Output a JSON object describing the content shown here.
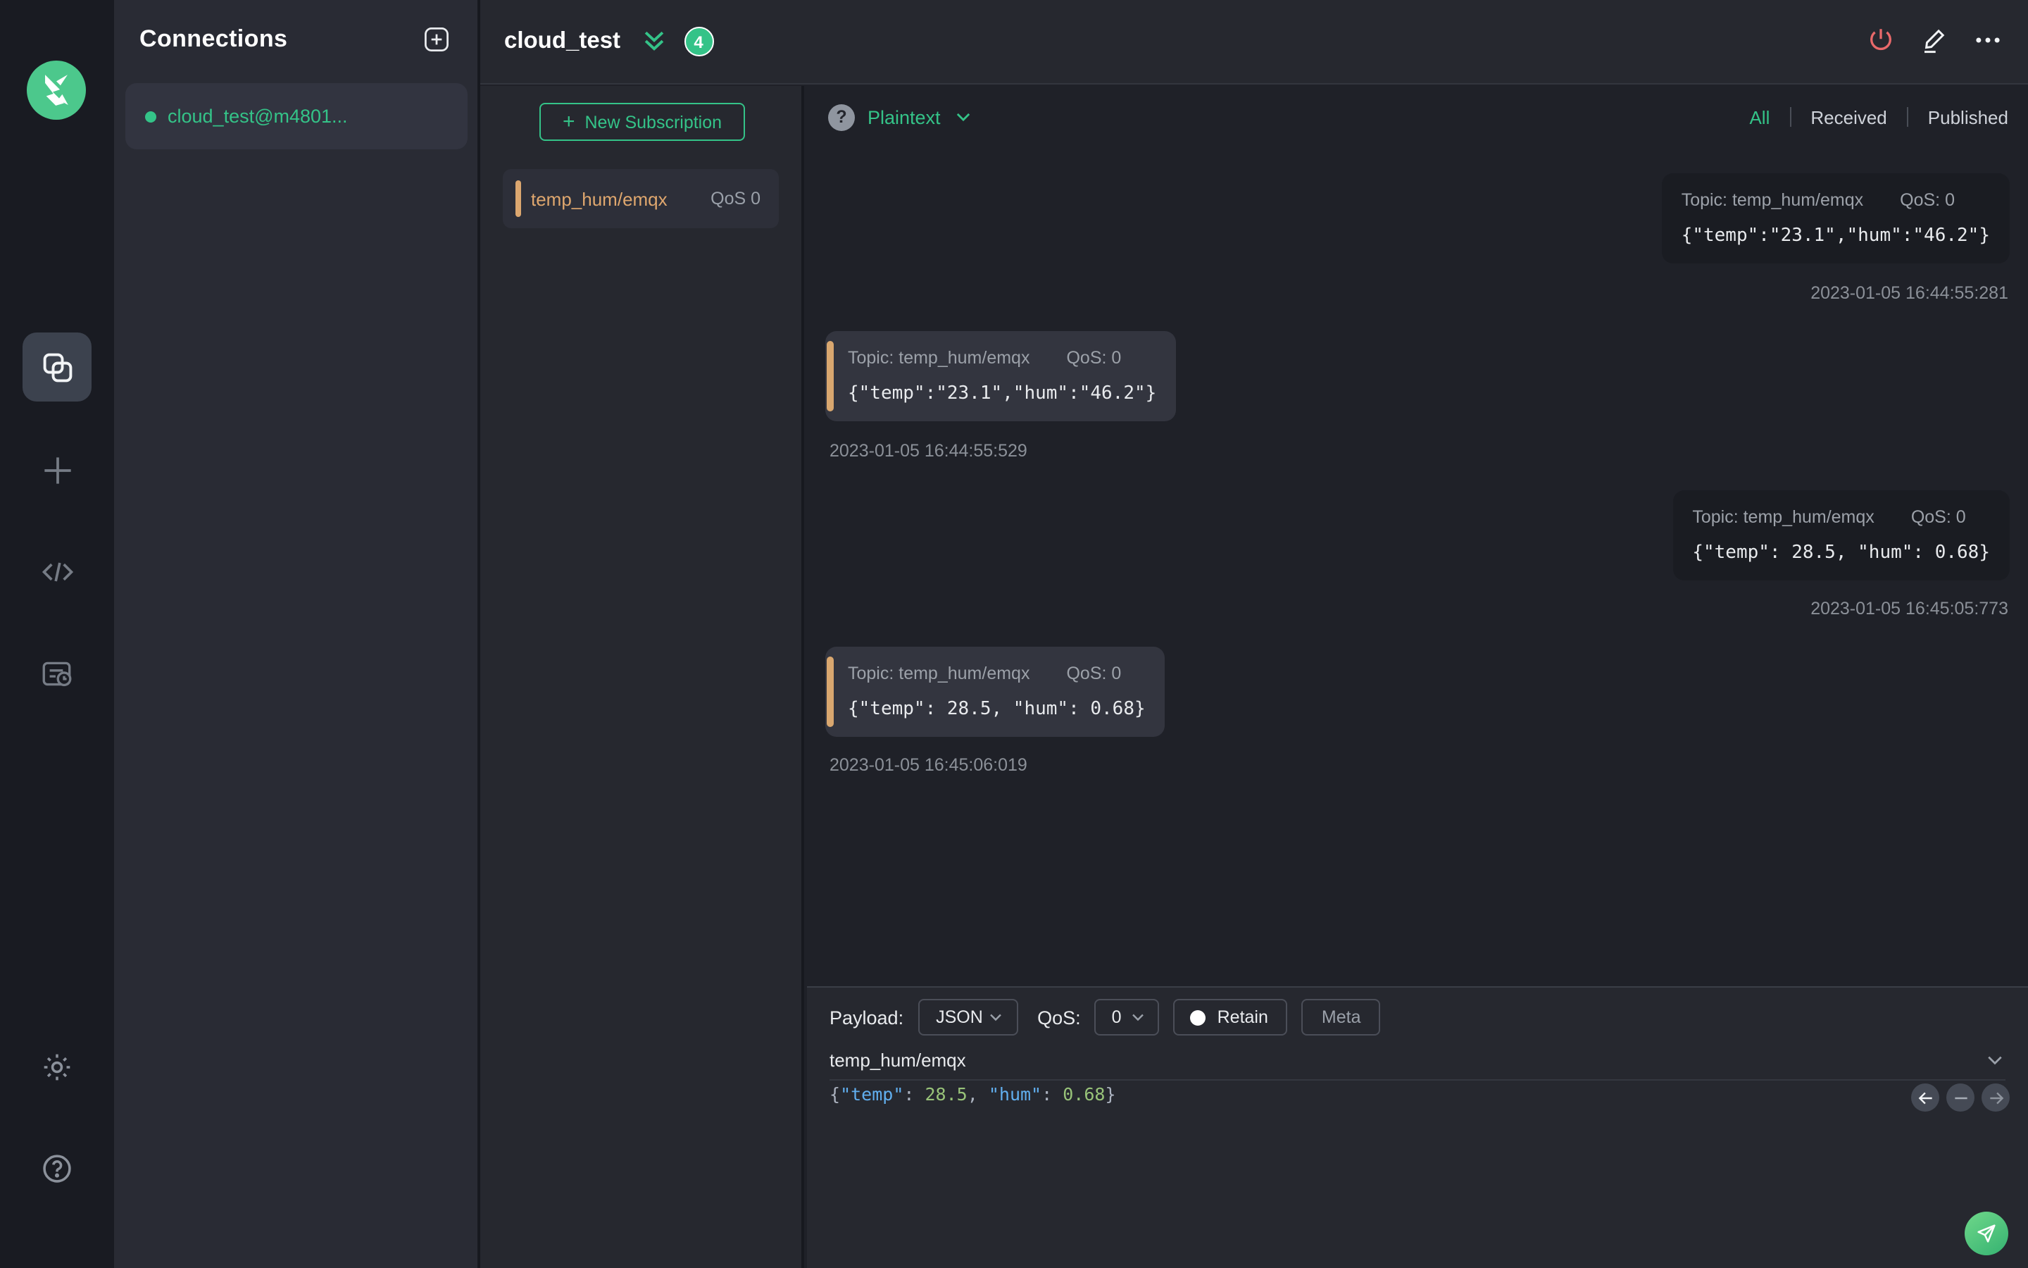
{
  "colors": {
    "accent_green": "#34c388",
    "topic_orange": "#dfa76e",
    "danger_red": "#e8696a"
  },
  "connections": {
    "title": "Connections",
    "items": [
      {
        "name": "cloud_test@m4801...",
        "active": true
      }
    ]
  },
  "connection_header": {
    "title": "cloud_test",
    "badge": "4"
  },
  "subscriptions": {
    "new_button_label": "New Subscription",
    "items": [
      {
        "topic": "temp_hum/emqx",
        "qos": "QoS 0"
      }
    ]
  },
  "messages": {
    "format_label": "Plaintext",
    "filters": {
      "all": "All",
      "received": "Received",
      "published": "Published",
      "active": "All"
    },
    "items": [
      {
        "direction": "published",
        "topic_label": "Topic: temp_hum/emqx",
        "qos_label": "QoS: 0",
        "payload": "{\"temp\":\"23.1\",\"hum\":\"46.2\"}",
        "timestamp": "2023-01-05 16:44:55:281"
      },
      {
        "direction": "received",
        "topic_label": "Topic: temp_hum/emqx",
        "qos_label": "QoS: 0",
        "payload": "{\"temp\":\"23.1\",\"hum\":\"46.2\"}",
        "timestamp": "2023-01-05 16:44:55:529"
      },
      {
        "direction": "published",
        "topic_label": "Topic: temp_hum/emqx",
        "qos_label": "QoS: 0",
        "payload": "{\"temp\": 28.5, \"hum\": 0.68}",
        "timestamp": "2023-01-05 16:45:05:773"
      },
      {
        "direction": "received",
        "topic_label": "Topic: temp_hum/emqx",
        "qos_label": "QoS: 0",
        "payload": "{\"temp\": 28.5, \"hum\": 0.68}",
        "timestamp": "2023-01-05 16:45:06:019"
      }
    ]
  },
  "publish": {
    "payload_label": "Payload:",
    "payload_type": "JSON",
    "qos_label": "QoS:",
    "qos_value": "0",
    "retain_label": "Retain",
    "meta_label": "Meta",
    "topic": "temp_hum/emqx",
    "editor": {
      "p1": "{",
      "k1": "\"temp\"",
      "c1": ": ",
      "n1": "28.5",
      "c2": ", ",
      "k2": "\"hum\"",
      "c3": ": ",
      "n2": "0.68",
      "p2": "}"
    }
  }
}
